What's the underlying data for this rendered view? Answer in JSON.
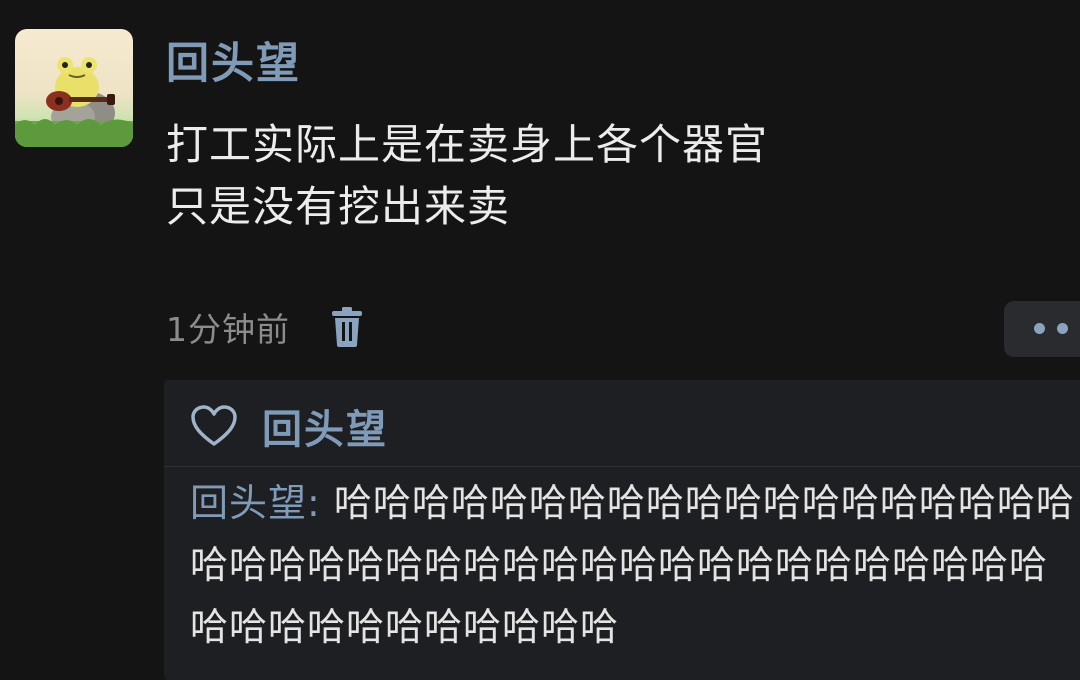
{
  "post": {
    "author": "回头望",
    "body_lines": [
      "打工实际上是在卖身上各个器官",
      "只是没有挖出来卖"
    ],
    "timestamp": "1分钟前"
  },
  "likes": {
    "names": "回头望"
  },
  "comment": {
    "author_label": "回头望:",
    "text": "哈哈哈哈哈哈哈哈哈哈哈哈哈哈哈哈哈哈哈哈哈哈哈哈哈哈哈哈哈哈哈哈哈哈哈哈哈哈哈哈哈哈哈哈哈哈哈哈哈哈哈哈"
  },
  "icons": {
    "delete": "trash-icon",
    "like": "heart-icon",
    "more": "more-dots-icon"
  },
  "colors": {
    "background": "#141414",
    "name_link": "#7f9bb8",
    "body_text": "#ececec",
    "muted_text": "#8c8c8c",
    "panel": "#1e1f22"
  }
}
